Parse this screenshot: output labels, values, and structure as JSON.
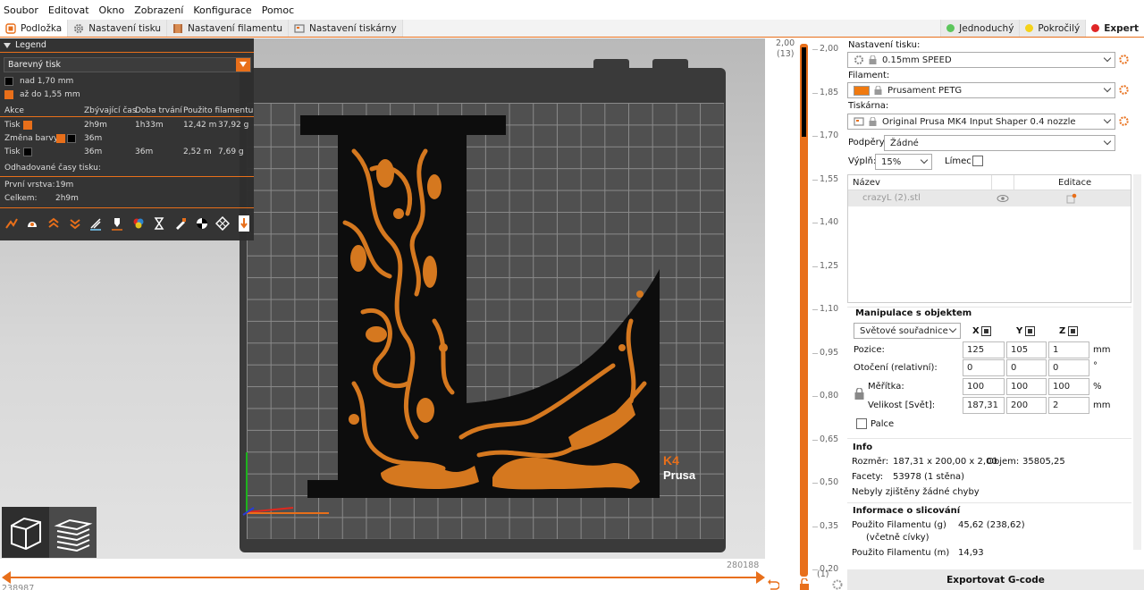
{
  "menu": [
    "Soubor",
    "Editovat",
    "Okno",
    "Zobrazení",
    "Konfigurace",
    "Pomoc"
  ],
  "tabs": [
    {
      "label": "Podložka",
      "icon": "plater-icon"
    },
    {
      "label": "Nastavení tisku",
      "icon": "gear-icon"
    },
    {
      "label": "Nastavení filamentu",
      "icon": "spool-icon"
    },
    {
      "label": "Nastavení tiskárny",
      "icon": "printer-icon"
    }
  ],
  "modes": [
    {
      "label": "Jednoduchý",
      "color": "#5cc65c"
    },
    {
      "label": "Pokročilý",
      "color": "#f5d31a"
    },
    {
      "label": "Expert",
      "color": "#e02626"
    }
  ],
  "legend": {
    "title": "Legend",
    "view_type": "Barevný tisk",
    "ranges": [
      {
        "label": "nad 1,70 mm",
        "color": "#000000"
      },
      {
        "label": "až do 1,55 mm",
        "color": "#e86f1a"
      }
    ],
    "columns": [
      "Akce",
      "Zbývající čas",
      "Doba trvání",
      "Použito filamentu"
    ],
    "rows": [
      {
        "action": "Tisk",
        "remaining": "2h9m",
        "duration": "1h33m",
        "length": "12,42 m",
        "weight": "37,92 g"
      },
      {
        "action": "Změna barvy",
        "remaining": "36m",
        "duration": "",
        "length": "",
        "weight": ""
      },
      {
        "action": "Tisk",
        "remaining": "36m",
        "duration": "36m",
        "length": "2,52 m",
        "weight": "7,69 g"
      }
    ],
    "estimated_label": "Odhadované časy tisku:",
    "first_layer_label": "První vrstva:",
    "first_layer_value": "19m",
    "total_label": "Celkem:",
    "total_value": "2h9m",
    "icons": [
      "travel-icon",
      "wipe-icon",
      "retraction-icon",
      "deretraction-icon",
      "seam-icon",
      "tool-change-icon",
      "color-change-icon",
      "pause-icon",
      "custom-gcode-icon",
      "center-of-gravity-icon",
      "shells-icon",
      "tool-marker-icon"
    ]
  },
  "bed": {
    "brand": "Prusa",
    "model_badge": "K4"
  },
  "hslider": {
    "right_value": "280188",
    "left_value": "238987"
  },
  "vslider": {
    "top_value": "2,00",
    "top_layer": "(13)",
    "bottom_value": "0,20",
    "bottom_layer": "(1)",
    "ticks": [
      "2,00",
      "1,85",
      "1,70",
      "1,55",
      "1,40",
      "1,25",
      "1,10",
      "0,95",
      "0,80",
      "0,65",
      "0,50",
      "0,35",
      "0,20"
    ]
  },
  "panel": {
    "print_settings_label": "Nastavení tisku:",
    "print_profile": "0.15mm SPEED",
    "filament_label": "Filament:",
    "filament_profile": "Prusament PETG",
    "filament_color": "#f07a10",
    "printer_label": "Tiskárna:",
    "printer_profile": "Original Prusa MK4 Input Shaper 0.4 nozzle",
    "supports_label": "Podpěry:",
    "supports_value": "Žádné",
    "infill_label": "Výplň:",
    "infill_value": "15%",
    "brim_label": "Límec:",
    "brim_checked": false,
    "list_col_name": "Název",
    "list_col_edit": "Editace",
    "object_name": "crazyL (2).stl",
    "manip_title": "Manipulace s objektem",
    "coord_mode": "Světové souřadnice",
    "axes": [
      "X",
      "Y",
      "Z"
    ],
    "position_label": "Pozice:",
    "position": [
      "125",
      "105",
      "1"
    ],
    "position_unit": "mm",
    "rotation_label": "Otočení (relativní):",
    "rotation": [
      "0",
      "0",
      "0"
    ],
    "rotation_unit": "°",
    "scale_label": "Měřítka:",
    "scale": [
      "100",
      "100",
      "100"
    ],
    "scale_unit": "%",
    "size_label": "Velikost [Svět]:",
    "size": [
      "187,31",
      "200",
      "2"
    ],
    "size_unit": "mm",
    "inches_label": "Palce",
    "info_title": "Info",
    "size_info_label": "Rozměr:",
    "size_info_value": "187,31 x 200,00 x 2,00",
    "volume_label": "Objem:",
    "volume_value": "35805,25",
    "facets_label": "Facety:",
    "facets_value": "53978 (1 stěna)",
    "errors_text": "Nebyly zjištěny žádné chyby",
    "slice_title": "Informace o slicování",
    "filament_g_label": "Použito Filamentu (g)",
    "filament_g_sub": "(včetně cívky)",
    "filament_g_value": "45,62 (238,62)",
    "filament_m_label": "Použito Filamentu (m)",
    "filament_m_value": "14,93",
    "export_label": "Exportovat G-code"
  }
}
